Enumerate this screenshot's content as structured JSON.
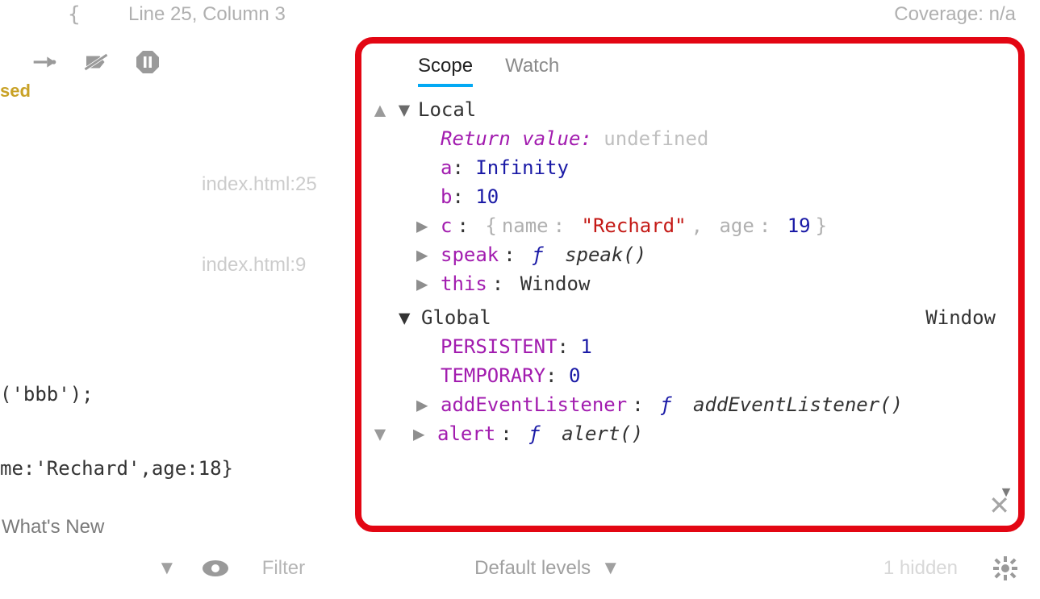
{
  "topbar": {
    "cursor": "Line 25, Column 3",
    "coverage": "Coverage: n/a"
  },
  "debug_icons": {
    "step_to": "step-icon",
    "no_breakpoints": "breakpoints-disabled-icon",
    "pause": "pause-on-exceptions-icon"
  },
  "paused": "sed",
  "locations": {
    "one": "index.html:25",
    "two": "index.html:9"
  },
  "code": {
    "l1": "('bbb');",
    "l2": "me:'Rechard',age:18}"
  },
  "whatsnew": "What's New",
  "console": {
    "filter_placeholder": "Filter",
    "levels": "Default levels",
    "hidden": "1 hidden"
  },
  "scope": {
    "tabs": {
      "scope": "Scope",
      "watch": "Watch"
    },
    "local_label": "Local",
    "local": {
      "return_label": "Return value",
      "return_val": "undefined",
      "a_key": "a",
      "a_val": "Infinity",
      "b_key": "b",
      "b_val": "10",
      "c_key": "c",
      "c_open": "{",
      "c_name_k": "name",
      "c_name_v": "\"Rechard\"",
      "c_age_k": "age",
      "c_age_v": "19",
      "c_close": "}",
      "speak_key": "speak",
      "fn_f": "ƒ",
      "speak_fn": "speak()",
      "this_key": "this",
      "this_val": "Window"
    },
    "global_label": "Global",
    "global_hint": "Window",
    "global": {
      "persistent_key": "PERSISTENT",
      "persistent_val": "1",
      "temporary_key": "TEMPORARY",
      "temporary_val": "0",
      "ael_key": "addEventListener",
      "ael_fn": "addEventListener()",
      "alert_key": "alert",
      "alert_fn": "alert()"
    }
  }
}
